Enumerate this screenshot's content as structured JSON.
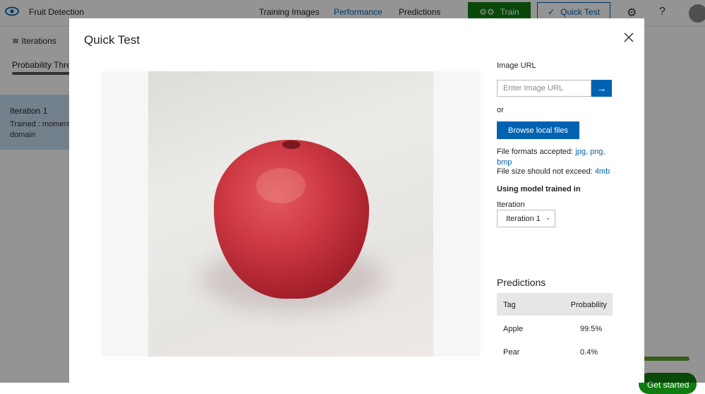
{
  "header": {
    "app_title": "Fruit Detection",
    "nav": [
      "Training Images",
      "Performance",
      "Predictions"
    ],
    "active_nav": "Performance",
    "train_label": "Train",
    "quick_test_label": "Quick Test",
    "icons": [
      "eye-logo-icon",
      "gear-icon",
      "help-icon",
      "user-avatar-icon"
    ]
  },
  "sidebar": {
    "iterations_label": "Iterations",
    "probability_label": "Probability Thresh",
    "iteration_card": {
      "title": "Iteration 1",
      "desc_line1": "Trained : moments",
      "desc_line2": "domain"
    }
  },
  "background": {
    "get_started": "Get started"
  },
  "modal": {
    "title": "Quick Test",
    "image_url_label": "Image URL",
    "image_url_placeholder": "Enter Image URL",
    "or_label": "or",
    "browse_label": "Browse local files",
    "formats_prefix": "File formats accepted:",
    "formats_line1": "jpg, png,",
    "formats_line2": "bmp",
    "size_prefix": "File size should not exceed:",
    "size_value": "4mb",
    "model_label": "Using model trained in",
    "iteration_label": "Iteration",
    "iteration_value": "Iteration 1",
    "predictions_title": "Predictions",
    "table_headers": [
      "Tag",
      "Probability"
    ],
    "predictions": [
      {
        "tag": "Apple",
        "probability": "99.5%"
      },
      {
        "tag": "Pear",
        "probability": "0.4%"
      }
    ]
  },
  "colors": {
    "accent": "#0063b1",
    "train_green": "#107c10",
    "selected_card": "#c7dff3"
  }
}
